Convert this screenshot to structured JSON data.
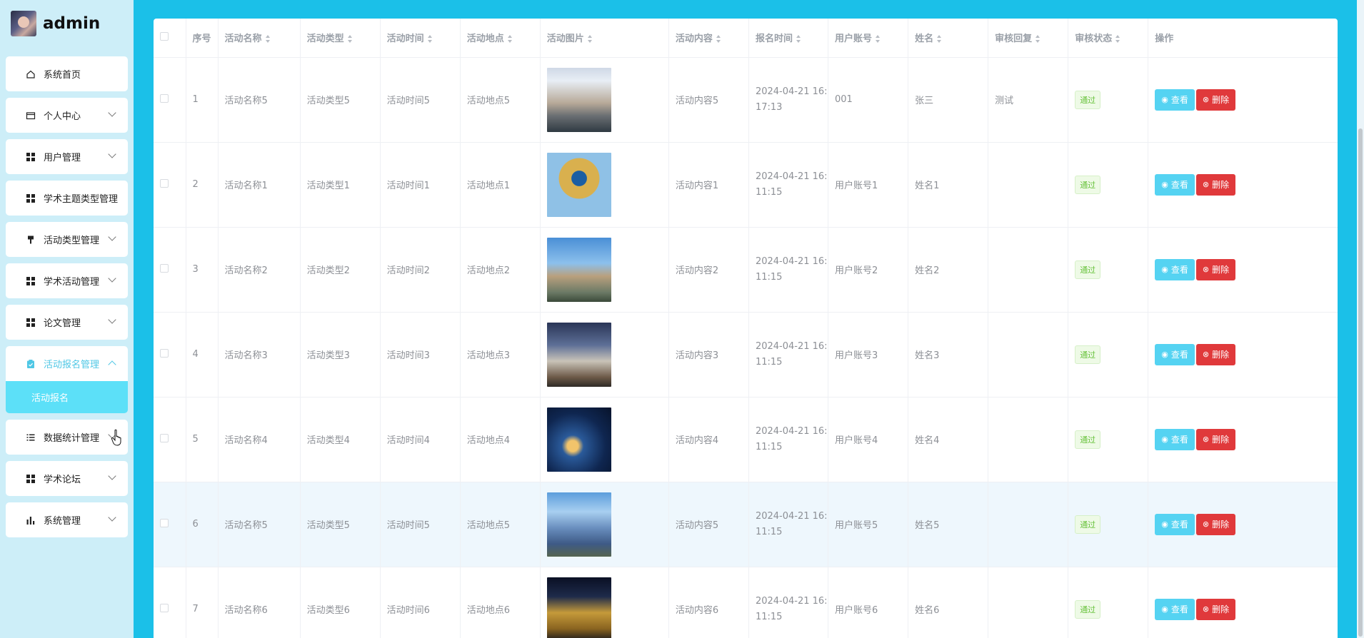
{
  "brand": {
    "name": "admin"
  },
  "sidebar": {
    "items": [
      {
        "label": "系统首页",
        "icon": "home-icon"
      },
      {
        "label": "个人中心",
        "icon": "wallet-icon"
      },
      {
        "label": "用户管理",
        "icon": "grid-icon"
      },
      {
        "label": "学术主题类型管理",
        "icon": "grid-icon"
      },
      {
        "label": "活动类型管理",
        "icon": "brush-icon"
      },
      {
        "label": "学术活动管理",
        "icon": "grid-icon"
      },
      {
        "label": "论文管理",
        "icon": "grid-icon"
      },
      {
        "label": "活动报名管理",
        "icon": "clipboard-icon"
      },
      {
        "label": "数据统计管理",
        "icon": "list-icon"
      },
      {
        "label": "学术论坛",
        "icon": "grid-icon"
      },
      {
        "label": "系统管理",
        "icon": "bar-chart-icon"
      }
    ],
    "submenu_label": "活动报名"
  },
  "table": {
    "headers": [
      "序号",
      "活动名称",
      "活动类型",
      "活动时间",
      "活动地点",
      "活动图片",
      "活动内容",
      "报名时间",
      "用户账号",
      "姓名",
      "审核回复",
      "审核状态",
      "操作"
    ],
    "rows": [
      {
        "idx": "1",
        "name": "活动名称5",
        "type": "活动类型5",
        "time": "活动时间5",
        "place": "活动地点5",
        "content": "活动内容5",
        "signup1": "2024-04-21 16:",
        "signup2": "17:13",
        "account": "001",
        "person": "张三",
        "reply": "测试",
        "status": "通过"
      },
      {
        "idx": "2",
        "name": "活动名称1",
        "type": "活动类型1",
        "time": "活动时间1",
        "place": "活动地点1",
        "content": "活动内容1",
        "signup1": "2024-04-21 16:",
        "signup2": "11:15",
        "account": "用户账号1",
        "person": "姓名1",
        "reply": "",
        "status": "通过"
      },
      {
        "idx": "3",
        "name": "活动名称2",
        "type": "活动类型2",
        "time": "活动时间2",
        "place": "活动地点2",
        "content": "活动内容2",
        "signup1": "2024-04-21 16:",
        "signup2": "11:15",
        "account": "用户账号2",
        "person": "姓名2",
        "reply": "",
        "status": "通过"
      },
      {
        "idx": "4",
        "name": "活动名称3",
        "type": "活动类型3",
        "time": "活动时间3",
        "place": "活动地点3",
        "content": "活动内容3",
        "signup1": "2024-04-21 16:",
        "signup2": "11:15",
        "account": "用户账号3",
        "person": "姓名3",
        "reply": "",
        "status": "通过"
      },
      {
        "idx": "5",
        "name": "活动名称4",
        "type": "活动类型4",
        "time": "活动时间4",
        "place": "活动地点4",
        "content": "活动内容4",
        "signup1": "2024-04-21 16:",
        "signup2": "11:15",
        "account": "用户账号4",
        "person": "姓名4",
        "reply": "",
        "status": "通过"
      },
      {
        "idx": "6",
        "name": "活动名称5",
        "type": "活动类型5",
        "time": "活动时间5",
        "place": "活动地点5",
        "content": "活动内容5",
        "signup1": "2024-04-21 16:",
        "signup2": "11:15",
        "account": "用户账号5",
        "person": "姓名5",
        "reply": "",
        "status": "通过"
      },
      {
        "idx": "7",
        "name": "活动名称6",
        "type": "活动类型6",
        "time": "活动时间6",
        "place": "活动地点6",
        "content": "活动内容6",
        "signup1": "2024-04-21 16:",
        "signup2": "11:15",
        "account": "用户账号6",
        "person": "姓名6",
        "reply": "",
        "status": "通过"
      }
    ],
    "actions": {
      "view": "查看",
      "delete": "删除"
    }
  },
  "colors": {
    "background": "#1bc0e8",
    "accent": "#55d3f2",
    "danger": "#e0393b",
    "success": "#67c23a"
  }
}
